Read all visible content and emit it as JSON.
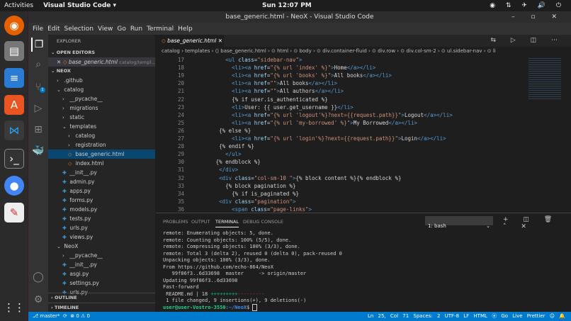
{
  "topbar": {
    "activities": "Activities",
    "app": "Visual Studio Code ▾",
    "clock": "Sun 12:07 PM"
  },
  "window": {
    "title": "base_generic.html - NeoX - Visual Studio Code"
  },
  "menu": [
    "File",
    "Edit",
    "Selection",
    "View",
    "Go",
    "Run",
    "Terminal",
    "Help"
  ],
  "sidebar": {
    "header": "EXPLORER",
    "open_editors": "OPEN EDITORS",
    "open_file": "base_generic.html",
    "open_path": "catalog/templ...",
    "root": "NEOX",
    "outline": "OUTLINE",
    "timeline": "TIMELINE",
    "tree": [
      {
        "label": ".github",
        "indent": 1,
        "kind": "folder-closed"
      },
      {
        "label": "catalog",
        "indent": 1,
        "kind": "folder-open"
      },
      {
        "label": "__pycache__",
        "indent": 2,
        "kind": "folder-closed"
      },
      {
        "label": "migrations",
        "indent": 2,
        "kind": "folder-closed"
      },
      {
        "label": "static",
        "indent": 2,
        "kind": "folder-closed"
      },
      {
        "label": "templates",
        "indent": 2,
        "kind": "folder-open"
      },
      {
        "label": "catalog",
        "indent": 3,
        "kind": "folder-closed"
      },
      {
        "label": "registration",
        "indent": 3,
        "kind": "folder-closed"
      },
      {
        "label": "base_generic.html",
        "indent": 3,
        "kind": "html",
        "selected": true
      },
      {
        "label": "index.html",
        "indent": 3,
        "kind": "html"
      },
      {
        "label": "__init__.py",
        "indent": 2,
        "kind": "py"
      },
      {
        "label": "admin.py",
        "indent": 2,
        "kind": "py"
      },
      {
        "label": "apps.py",
        "indent": 2,
        "kind": "py"
      },
      {
        "label": "forms.py",
        "indent": 2,
        "kind": "py"
      },
      {
        "label": "models.py",
        "indent": 2,
        "kind": "py"
      },
      {
        "label": "tests.py",
        "indent": 2,
        "kind": "py"
      },
      {
        "label": "urls.py",
        "indent": 2,
        "kind": "py"
      },
      {
        "label": "views.py",
        "indent": 2,
        "kind": "py"
      },
      {
        "label": "NeoX",
        "indent": 1,
        "kind": "folder-open"
      },
      {
        "label": "__pycache__",
        "indent": 2,
        "kind": "folder-closed"
      },
      {
        "label": "__init__.py",
        "indent": 2,
        "kind": "py"
      },
      {
        "label": "asgi.py",
        "indent": 2,
        "kind": "py"
      },
      {
        "label": "settings.py",
        "indent": 2,
        "kind": "py"
      },
      {
        "label": "urls.py",
        "indent": 2,
        "kind": "py"
      }
    ],
    "scm_badge": "1"
  },
  "editor": {
    "tab": "base_generic.html",
    "breadcrumb": "catalog › templates › ⟨⟩ base_generic.html › ⊙ html › ⊙ body › ⊙ div.container-fluid › ⊙ div.row › ⊙ div.col-sm-2 › ⊙ ul.sidebar-nav › ⊙ li",
    "lines": [
      {
        "n": 17,
        "tokens": [
          [
            "x",
            "        "
          ],
          [
            "t",
            "<ul "
          ],
          [
            "a",
            "class"
          ],
          [
            "x",
            "="
          ],
          [
            "s",
            "\"sidebar-nav\""
          ],
          [
            "t",
            ">"
          ]
        ]
      },
      {
        "n": 18,
        "tokens": [
          [
            "x",
            "          "
          ],
          [
            "t",
            "<li><a "
          ],
          [
            "a",
            "href"
          ],
          [
            "x",
            "="
          ],
          [
            "s",
            "\"{% url 'index' %}\""
          ],
          [
            "t",
            ">"
          ],
          [
            "x",
            "Home"
          ],
          [
            "t",
            "</a></li>"
          ]
        ]
      },
      {
        "n": 19,
        "tokens": [
          [
            "x",
            "          "
          ],
          [
            "t",
            "<li><a "
          ],
          [
            "a",
            "href"
          ],
          [
            "x",
            "="
          ],
          [
            "s",
            "\"{% url 'books' %}\""
          ],
          [
            "t",
            ">"
          ],
          [
            "x",
            "All books"
          ],
          [
            "t",
            "</a></li>"
          ]
        ]
      },
      {
        "n": 20,
        "tokens": [
          [
            "x",
            "          "
          ],
          [
            "t",
            "<li><a "
          ],
          [
            "a",
            "href"
          ],
          [
            "x",
            "="
          ],
          [
            "s",
            "\"\""
          ],
          [
            "t",
            ">"
          ],
          [
            "x",
            "All books"
          ],
          [
            "t",
            "</a></li>"
          ]
        ]
      },
      {
        "n": 21,
        "tokens": [
          [
            "x",
            "          "
          ],
          [
            "t",
            "<li><a "
          ],
          [
            "a",
            "href"
          ],
          [
            "x",
            "="
          ],
          [
            "s",
            "\"\""
          ],
          [
            "t",
            ">"
          ],
          [
            "x",
            "All authors"
          ],
          [
            "t",
            "</a></li>"
          ]
        ]
      },
      {
        "n": 22,
        "tokens": [
          [
            "x",
            "          {% if user.is_authenticated %}"
          ]
        ]
      },
      {
        "n": 23,
        "tokens": [
          [
            "x",
            "          "
          ],
          [
            "t",
            "<li>"
          ],
          [
            "x",
            "User: {{ user.get_username }}"
          ],
          [
            "t",
            "</li>"
          ]
        ]
      },
      {
        "n": 24,
        "tokens": [
          [
            "x",
            "          "
          ],
          [
            "t",
            "<li><a "
          ],
          [
            "a",
            "href"
          ],
          [
            "x",
            "="
          ],
          [
            "s",
            "\"{% url 'logout'%}?next={{request.path}}\""
          ],
          [
            "t",
            ">"
          ],
          [
            "x",
            "Logout"
          ],
          [
            "t",
            "</a></li>"
          ]
        ]
      },
      {
        "n": 25,
        "tokens": [
          [
            "x",
            "          "
          ],
          [
            "t",
            "<li><a "
          ],
          [
            "a",
            "href"
          ],
          [
            "x",
            "="
          ],
          [
            "s",
            "\"{% url 'my-borrowed' %}\""
          ],
          [
            "t",
            ">"
          ],
          [
            "x",
            "My Borrowed"
          ],
          [
            "t",
            "</a></li>"
          ]
        ]
      },
      {
        "n": 26,
        "tokens": [
          [
            "x",
            "      {% else %}"
          ]
        ]
      },
      {
        "n": 27,
        "tokens": [
          [
            "x",
            "          "
          ],
          [
            "t",
            "<li><a "
          ],
          [
            "a",
            "href"
          ],
          [
            "x",
            "="
          ],
          [
            "s",
            "\"{% url 'login'%}?next={{request.path}}\""
          ],
          [
            "t",
            ">"
          ],
          [
            "x",
            "Login"
          ],
          [
            "t",
            "</a></li>"
          ]
        ]
      },
      {
        "n": 28,
        "tokens": [
          [
            "x",
            "      {% endif %}"
          ]
        ]
      },
      {
        "n": 29,
        "tokens": [
          [
            "x",
            "        "
          ],
          [
            "t",
            "</ul>"
          ]
        ]
      },
      {
        "n": 30,
        "tokens": [
          [
            "x",
            "     {% endblock %}"
          ]
        ]
      },
      {
        "n": 31,
        "tokens": [
          [
            "x",
            "      "
          ],
          [
            "t",
            "</div>"
          ]
        ]
      },
      {
        "n": 32,
        "tokens": [
          [
            "x",
            "      "
          ],
          [
            "t",
            "<div "
          ],
          [
            "a",
            "class"
          ],
          [
            "x",
            "="
          ],
          [
            "s",
            "\"col-sm-10 \""
          ],
          [
            "t",
            ">"
          ],
          [
            "x",
            "{% block content %}{% endblock %}"
          ]
        ]
      },
      {
        "n": 33,
        "tokens": [
          [
            "x",
            "        {% block pagination %}"
          ]
        ]
      },
      {
        "n": 34,
        "tokens": [
          [
            "x",
            "          {% if is_paginated %}"
          ]
        ]
      },
      {
        "n": 35,
        "tokens": [
          [
            "x",
            "      "
          ],
          [
            "t",
            "<div "
          ],
          [
            "a",
            "class"
          ],
          [
            "x",
            "="
          ],
          [
            "s",
            "\"pagination\""
          ],
          [
            "t",
            ">"
          ]
        ]
      },
      {
        "n": 36,
        "tokens": [
          [
            "x",
            "          "
          ],
          [
            "t",
            "<span "
          ],
          [
            "a",
            "class"
          ],
          [
            "x",
            "="
          ],
          [
            "s",
            "\"page-links\""
          ],
          [
            "t",
            ">"
          ]
        ]
      }
    ]
  },
  "panel": {
    "tabs": [
      "PROBLEMS",
      "OUTPUT",
      "TERMINAL",
      "DEBUG CONSOLE"
    ],
    "active": "TERMINAL",
    "shell": "1: bash",
    "terminal": [
      "remote: Enumerating objects: 5, done.",
      "remote: Counting objects: 100% (5/5), done.",
      "remote: Compressing objects: 100% (3/3), done.",
      "remote: Total 3 (delta 2), reused 0 (delta 0), pack-reused 0",
      "Unpacking objects: 100% (3/3), done.",
      "From https://github.com/echo-864/NeoX",
      "   99f86f3..6d33698  master     -> origin/master",
      "Updating 99f86f3..6d33698",
      "Fast-forward"
    ],
    "diffstat_file": " README.md | 18 ",
    "diffstat_plus": "+++++++++",
    "diffstat_minus": "---------",
    "summary": " 1 file changed, 9 insertions(+), 9 deletions(-)",
    "prompt_user": "user@user-Vostro-3550",
    "prompt_path": ":~/NeoX",
    "prompt_end": "$ "
  },
  "status": {
    "branch": "⎇ master*",
    "sync": "⟳",
    "problems": "⊗ 0 ⚠ 0",
    "right": "Ln 25, Col 71   Spaces: 2   UTF-8   LF   HTML   ⦿ Go Live   Prettier   ☺   🔔"
  },
  "colors": {
    "accent": "#007acc",
    "selection": "#094771"
  }
}
